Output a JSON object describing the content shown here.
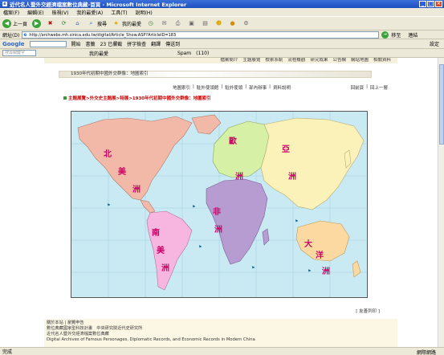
{
  "window": {
    "title": "近代名人暨外交經濟檔案數位典藏-首頁 - Microsoft Internet Explorer"
  },
  "menu": [
    "檔案(F)",
    "編輯(E)",
    "檢視(V)",
    "我的最愛(A)",
    "工具(T)",
    "說明(H)"
  ],
  "toolbar": {
    "back_label": "上一頁",
    "search_label": "搜尋",
    "favorites_label": "我的最愛"
  },
  "address": {
    "label": "網址(D)",
    "url": "http://archwebs.mh.sinica.edu.tw/digital/Article_Show.ASP?ArticleID=183",
    "go_label": "移至",
    "links_label": "連結"
  },
  "googlebar": {
    "logo": "Google",
    "go_label": "開始",
    "bookmarks_label": "書籤",
    "blocked_label": "23 已攔截",
    "spell_label": "拼字檢查",
    "translate_label": "翻譯",
    "send_label": "傳送到",
    "settings_label": "設定"
  },
  "linksbar": {
    "search_placeholder": "搜尋關鍵字",
    "favorites_label": "我的最愛",
    "spam_label": "Spam",
    "count_label": "(110)"
  },
  "page": {
    "topnav": [
      "檔案簡介",
      "主題展覽",
      "檢索系統",
      "流程概觀",
      "研究成果",
      "公告欄",
      "網站地圖",
      "相關資料"
    ],
    "banner": "1930年代初期中國外交群像：地圖索引",
    "subnav": [
      "地圖索引",
      "駐外使領館",
      "駐外使領",
      "部內辦事",
      "資料說明"
    ],
    "subnav_right": [
      "回前頁",
      "回上一層"
    ],
    "breadcrumb": "主題展覽>外交史主題展>特展>1930年代初期中國外交群像：地圖索引",
    "fontsize": "[ 友善列印 ]",
    "footer": {
      "line1": "關於本站 | 瀏覽申告",
      "line2": "數位典藏國家型科技計畫　中央研究院近代史研究所",
      "line3": "近代名人暨外交經濟檔案數位典藏",
      "line4": "Digital Archives of Famous Personages, Diplomatic Records, and Economic Records in Modern China"
    }
  },
  "map": {
    "labels": {
      "north_america": [
        "北",
        "美",
        "洲"
      ],
      "south_america": [
        "南",
        "美",
        "洲"
      ],
      "europe": [
        "歐",
        "洲"
      ],
      "asia": [
        "亞",
        "洲"
      ],
      "africa": [
        "非",
        "洲"
      ],
      "oceania": [
        "大",
        "洋",
        "洲"
      ]
    },
    "colors": {
      "ocean": "#c9e9f3",
      "north_america": "#f2b9a8",
      "south_america": "#f7b6e0",
      "europe": "#d6f0a6",
      "asia": "#fbf2ba",
      "africa": "#b79cd1",
      "oceania": "#fbd9a0",
      "label": "#cc0066"
    }
  },
  "status": {
    "text": "完成",
    "zone": "網際網路"
  }
}
